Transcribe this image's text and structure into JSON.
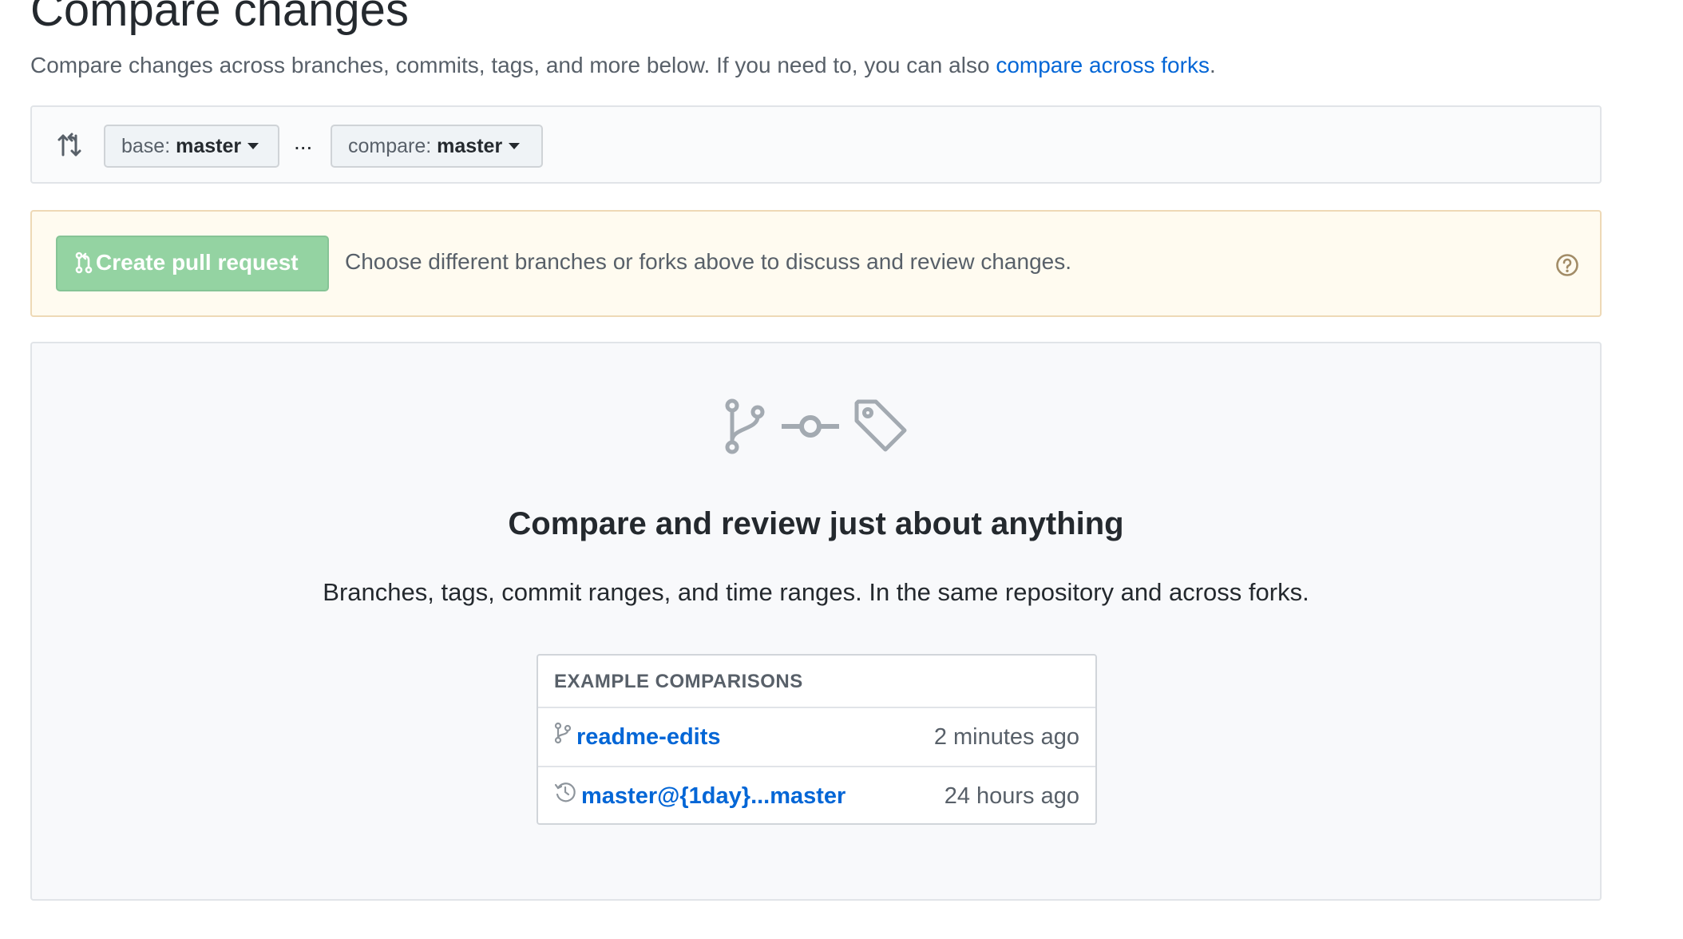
{
  "page": {
    "title": "Compare changes",
    "subtitle_text": "Compare changes across branches, commits, tags, and more below. If you need to, you can also ",
    "subtitle_link": "compare across forks",
    "subtitle_end": "."
  },
  "range": {
    "icon": "git-compare-icon",
    "base_label": "base:",
    "base_value": "master",
    "separator": "...",
    "compare_label": "compare:",
    "compare_value": "master"
  },
  "flash": {
    "button_label": "Create pull request",
    "button_icon": "git-pull-request-icon",
    "message": "Choose different branches or forks above to discuss and review changes.",
    "help_icon": "question-icon"
  },
  "blankslate": {
    "icons": [
      "git-branch-icon",
      "git-commit-icon",
      "tag-icon"
    ],
    "heading": "Compare and review just about anything",
    "description": "Branches, tags, commit ranges, and time ranges. In the same repository and across forks."
  },
  "examples": {
    "header": "EXAMPLE COMPARISONS",
    "items": [
      {
        "icon": "git-branch-icon",
        "label": "readme-edits",
        "time": "2 minutes ago"
      },
      {
        "icon": "history-icon",
        "label": "master@{1day}...master",
        "time": "24 hours ago"
      }
    ]
  },
  "colors": {
    "link": "#0366d6",
    "create_button": "#94d3a2",
    "flash_bg": "#fffbf0",
    "icon_gray": "#a3aab1"
  }
}
